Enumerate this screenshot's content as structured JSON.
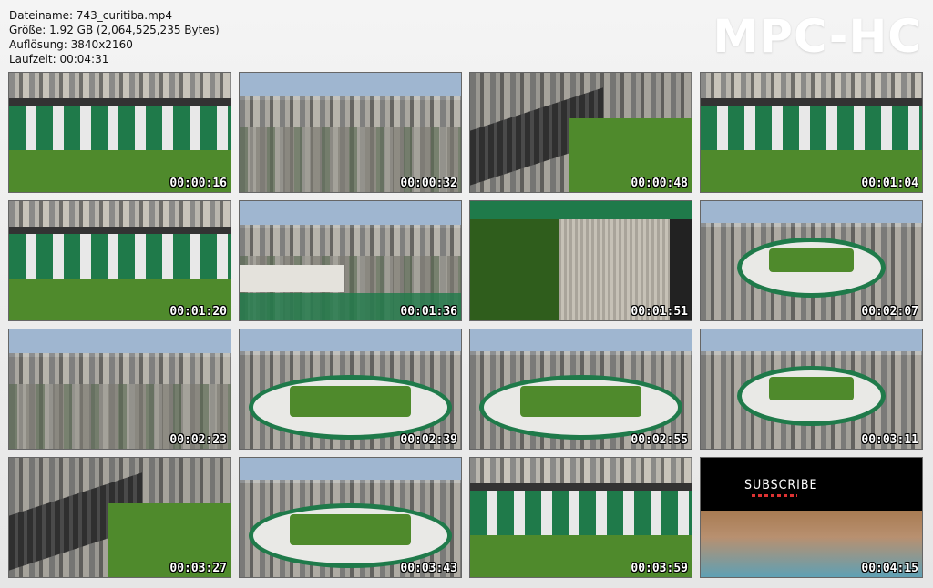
{
  "info": {
    "filename": "Dateiname: 743_curitiba.mp4",
    "size": "Größe: 1.92 GB (2,064,525,235 Bytes)",
    "resolution": "Auflösung: 3840x2160",
    "duration": "Laufzeit: 00:04:31"
  },
  "logo": "MPC-HC",
  "thumbnails": [
    {
      "time": "00:00:16",
      "scene": "stands-front"
    },
    {
      "time": "00:00:32",
      "scene": "city"
    },
    {
      "time": "00:00:48",
      "scene": "stadium-corner"
    },
    {
      "time": "00:01:04",
      "scene": "stands-wide"
    },
    {
      "time": "00:01:20",
      "scene": "stands-front"
    },
    {
      "time": "00:01:36",
      "scene": "city-roof"
    },
    {
      "time": "00:01:51",
      "scene": "roof-pitch"
    },
    {
      "time": "00:02:07",
      "scene": "stadium-aerial"
    },
    {
      "time": "00:02:23",
      "scene": "city"
    },
    {
      "time": "00:02:39",
      "scene": "stadium-oval"
    },
    {
      "time": "00:02:55",
      "scene": "stadium-oval"
    },
    {
      "time": "00:03:11",
      "scene": "stadium-aerial"
    },
    {
      "time": "00:03:27",
      "scene": "stadium-corner"
    },
    {
      "time": "00:03:43",
      "scene": "stadium-oval"
    },
    {
      "time": "00:03:59",
      "scene": "stands-wide"
    },
    {
      "time": "00:04:15",
      "scene": "subscribe"
    }
  ],
  "subscribe": {
    "title": "SUBSCRIBE"
  },
  "colors": {
    "pitch": "#4f8a2c",
    "stands_green": "#1f7a4a",
    "sky": "#9fb6d0"
  }
}
